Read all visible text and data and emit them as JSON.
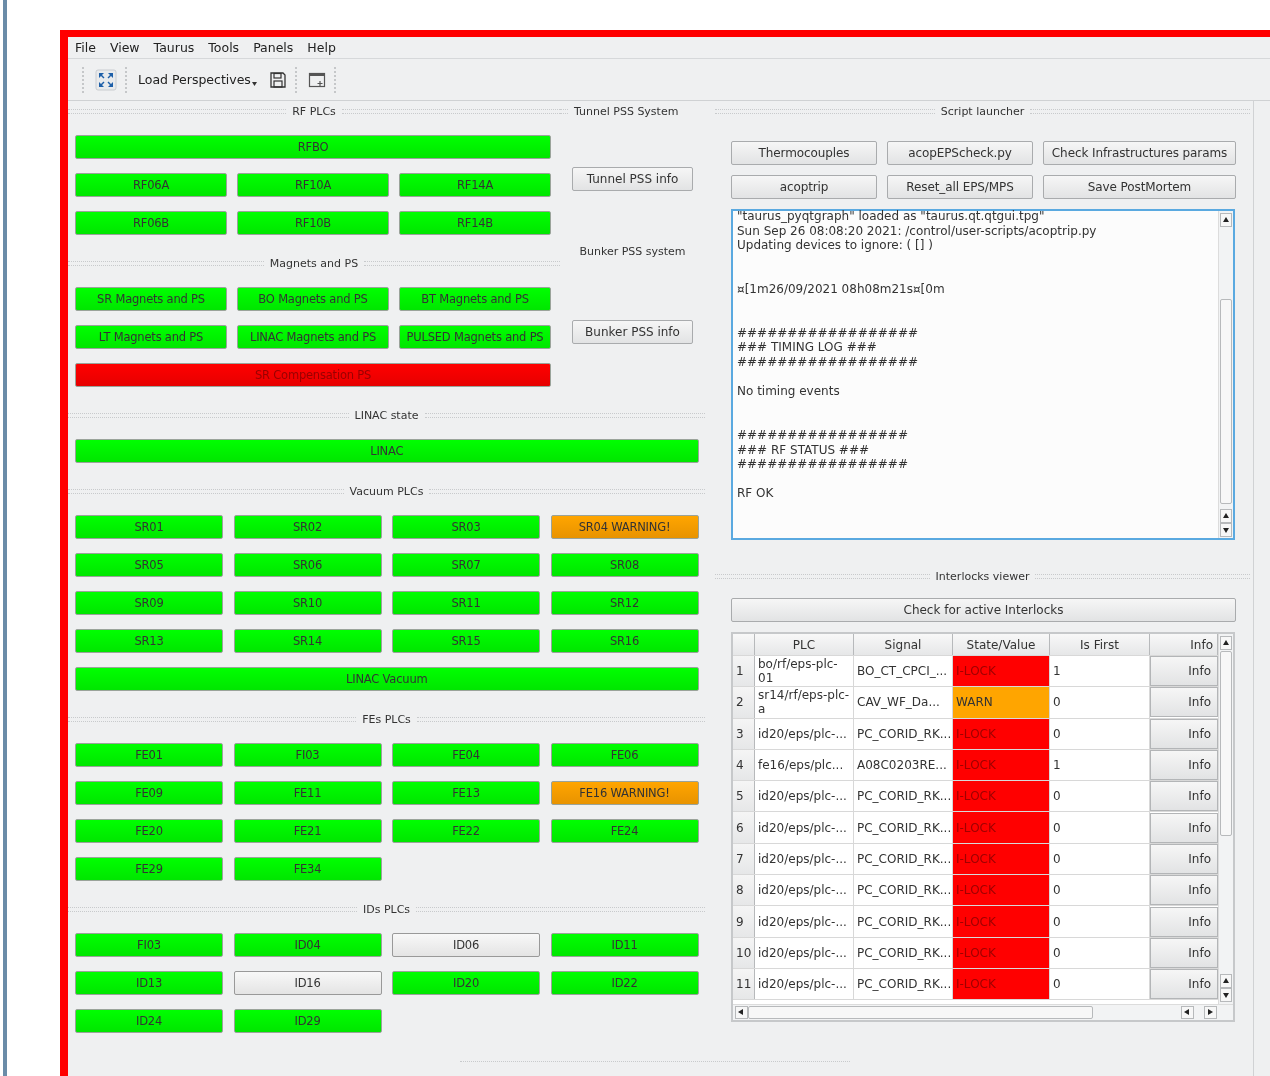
{
  "menu": [
    "File",
    "View",
    "Taurus",
    "Tools",
    "Panels",
    "Help"
  ],
  "toolbar": {
    "perspectives": "Load Perspectives"
  },
  "rf_sections": [
    {
      "title": "RF PLCs",
      "buttons": [
        {
          "label": "RFBO",
          "kind": "ok",
          "wide": true
        },
        {
          "label": "RF06A",
          "kind": "ok",
          "wide": false
        },
        {
          "label": "RF10A",
          "kind": "ok",
          "wide": false
        },
        {
          "label": "RF14A",
          "kind": "ok",
          "wide": false
        },
        {
          "label": "RF06B",
          "kind": "ok",
          "wide": false
        },
        {
          "label": "RF10B",
          "kind": "ok",
          "wide": false
        },
        {
          "label": "RF14B",
          "kind": "ok",
          "wide": false
        }
      ]
    },
    {
      "title": "Magnets and PS",
      "buttons": [
        {
          "label": "SR Magnets and PS",
          "kind": "ok",
          "wide": false
        },
        {
          "label": "BO Magnets and PS",
          "kind": "ok",
          "wide": false
        },
        {
          "label": "BT Magnets and PS",
          "kind": "ok",
          "wide": false
        },
        {
          "label": "LT Magnets and PS",
          "kind": "ok",
          "wide": false
        },
        {
          "label": "LINAC Magnets and PS",
          "kind": "ok",
          "wide": false
        },
        {
          "label": "PULSED Magnets and PS",
          "kind": "ok",
          "wide": false
        },
        {
          "label": "SR Compensation PS",
          "kind": "alarm",
          "wide": true
        }
      ]
    }
  ],
  "pss": {
    "tunnel_title": "Tunnel PSS System",
    "tunnel_button": "Tunnel PSS info",
    "bunker_title": "Bunker PSS system",
    "bunker_button": "Bunker PSS info"
  },
  "sections": [
    {
      "title": "LINAC state",
      "buttons": [
        {
          "label": "LINAC",
          "kind": "ok",
          "wide": true
        }
      ]
    },
    {
      "title": "Vacuum PLCs",
      "buttons": [
        {
          "label": "SR01",
          "kind": "ok",
          "wide": false
        },
        {
          "label": "SR02",
          "kind": "ok",
          "wide": false
        },
        {
          "label": "SR03",
          "kind": "ok",
          "wide": false
        },
        {
          "label": "SR04 WARNING!",
          "kind": "warning",
          "wide": false
        },
        {
          "label": "SR05",
          "kind": "ok",
          "wide": false
        },
        {
          "label": "SR06",
          "kind": "ok",
          "wide": false
        },
        {
          "label": "SR07",
          "kind": "ok",
          "wide": false
        },
        {
          "label": "SR08",
          "kind": "ok",
          "wide": false
        },
        {
          "label": "SR09",
          "kind": "ok",
          "wide": false
        },
        {
          "label": "SR10",
          "kind": "ok",
          "wide": false
        },
        {
          "label": "SR11",
          "kind": "ok",
          "wide": false
        },
        {
          "label": "SR12",
          "kind": "ok",
          "wide": false
        },
        {
          "label": "SR13",
          "kind": "ok",
          "wide": false
        },
        {
          "label": "SR14",
          "kind": "ok",
          "wide": false
        },
        {
          "label": "SR15",
          "kind": "ok",
          "wide": false
        },
        {
          "label": "SR16",
          "kind": "ok",
          "wide": false
        },
        {
          "label": "LINAC Vacuum",
          "kind": "ok",
          "wide": true
        }
      ]
    },
    {
      "title": "FEs PLCs",
      "buttons": [
        {
          "label": "FE01",
          "kind": "ok",
          "wide": false
        },
        {
          "label": "FI03",
          "kind": "ok",
          "wide": false
        },
        {
          "label": "FE04",
          "kind": "ok",
          "wide": false
        },
        {
          "label": "FE06",
          "kind": "ok",
          "wide": false
        },
        {
          "label": "FE09",
          "kind": "ok",
          "wide": false
        },
        {
          "label": "FE11",
          "kind": "ok",
          "wide": false
        },
        {
          "label": "FE13",
          "kind": "ok",
          "wide": false
        },
        {
          "label": "FE16 WARNING!",
          "kind": "warning",
          "wide": false
        },
        {
          "label": "FE20",
          "kind": "ok",
          "wide": false
        },
        {
          "label": "FE21",
          "kind": "ok",
          "wide": false
        },
        {
          "label": "FE22",
          "kind": "ok",
          "wide": false
        },
        {
          "label": "FE24",
          "kind": "ok",
          "wide": false
        },
        {
          "label": "FE29",
          "kind": "ok",
          "wide": false
        },
        {
          "label": "FE34",
          "kind": "ok",
          "wide": false
        }
      ]
    },
    {
      "title": "IDs PLCs",
      "buttons": [
        {
          "label": "FI03",
          "kind": "ok",
          "wide": false
        },
        {
          "label": "ID04",
          "kind": "ok",
          "wide": false
        },
        {
          "label": "ID06",
          "kind": "unknown",
          "wide": false
        },
        {
          "label": "ID11",
          "kind": "ok",
          "wide": false
        },
        {
          "label": "ID13",
          "kind": "ok",
          "wide": false
        },
        {
          "label": "ID16",
          "kind": "unknown",
          "wide": false
        },
        {
          "label": "ID20",
          "kind": "ok",
          "wide": false
        },
        {
          "label": "ID22",
          "kind": "ok",
          "wide": false
        },
        {
          "label": "ID24",
          "kind": "ok",
          "wide": false
        },
        {
          "label": "ID29",
          "kind": "ok",
          "wide": false
        }
      ]
    }
  ],
  "script_launcher": {
    "title": "Script launcher",
    "buttons": [
      "Thermocouples",
      "acopEPScheck.py",
      "Check Infrastructures params",
      "acoptrip",
      "Reset_all EPS/MPS",
      "Save PostMortem"
    ],
    "log": "\"taurus_pyqtgraph\" loaded as \"taurus.qt.qtgui.tpg\"\nSun Sep 26 08:08:20 2021: /control/user-scripts/acoptrip.py\nUpdating devices to ignore: ( [] )\n\n\n¤[1m26/09/2021 08h08m21s¤[0m\n\n\n##################\n### TIMING LOG ###\n##################\n\nNo timing events\n\n\n#################\n### RF STATUS ###\n#################\n\nRF OK"
  },
  "interlocks": {
    "title": "Interlocks viewer",
    "button": "Check for active Interlocks",
    "columns": [
      "PLC",
      "Signal",
      "State/Value",
      "Is First",
      "Info"
    ],
    "rows": [
      {
        "index": "1",
        "plc": "bo/rf/eps-plc-01",
        "signal": "BO_CT_CPCI_...",
        "state": "I-LOCK",
        "kind": "alarm",
        "is_first": "1",
        "info": "Info"
      },
      {
        "index": "2",
        "plc": "sr14/rf/eps-plc-a",
        "signal": "CAV_WF_Da...",
        "state": "WARN",
        "kind": "warning",
        "is_first": "0",
        "info": "Info"
      },
      {
        "index": "3",
        "plc": "id20/eps/plc-...",
        "signal": "PC_CORID_RK...",
        "state": "I-LOCK",
        "kind": "alarm",
        "is_first": "0",
        "info": "Info"
      },
      {
        "index": "4",
        "plc": "fe16/eps/plc...",
        "signal": "A08C0203RE...",
        "state": "I-LOCK",
        "kind": "alarm",
        "is_first": "1",
        "info": "Info"
      },
      {
        "index": "5",
        "plc": "id20/eps/plc-...",
        "signal": "PC_CORID_RK...",
        "state": "I-LOCK",
        "kind": "alarm",
        "is_first": "0",
        "info": "Info"
      },
      {
        "index": "6",
        "plc": "id20/eps/plc-...",
        "signal": "PC_CORID_RK...",
        "state": "I-LOCK",
        "kind": "alarm",
        "is_first": "0",
        "info": "Info"
      },
      {
        "index": "7",
        "plc": "id20/eps/plc-...",
        "signal": "PC_CORID_RK...",
        "state": "I-LOCK",
        "kind": "alarm",
        "is_first": "0",
        "info": "Info"
      },
      {
        "index": "8",
        "plc": "id20/eps/plc-...",
        "signal": "PC_CORID_RK...",
        "state": "I-LOCK",
        "kind": "alarm",
        "is_first": "0",
        "info": "Info"
      },
      {
        "index": "9",
        "plc": "id20/eps/plc-...",
        "signal": "PC_CORID_RK...",
        "state": "I-LOCK",
        "kind": "alarm",
        "is_first": "0",
        "info": "Info"
      },
      {
        "index": "10",
        "plc": "id20/eps/plc-...",
        "signal": "PC_CORID_RK...",
        "state": "I-LOCK",
        "kind": "alarm",
        "is_first": "0",
        "info": "Info"
      },
      {
        "index": "11",
        "plc": "id20/eps/plc-...",
        "signal": "PC_CORID_RK...",
        "state": "I-LOCK",
        "kind": "alarm",
        "is_first": "0",
        "info": "Info"
      }
    ]
  }
}
